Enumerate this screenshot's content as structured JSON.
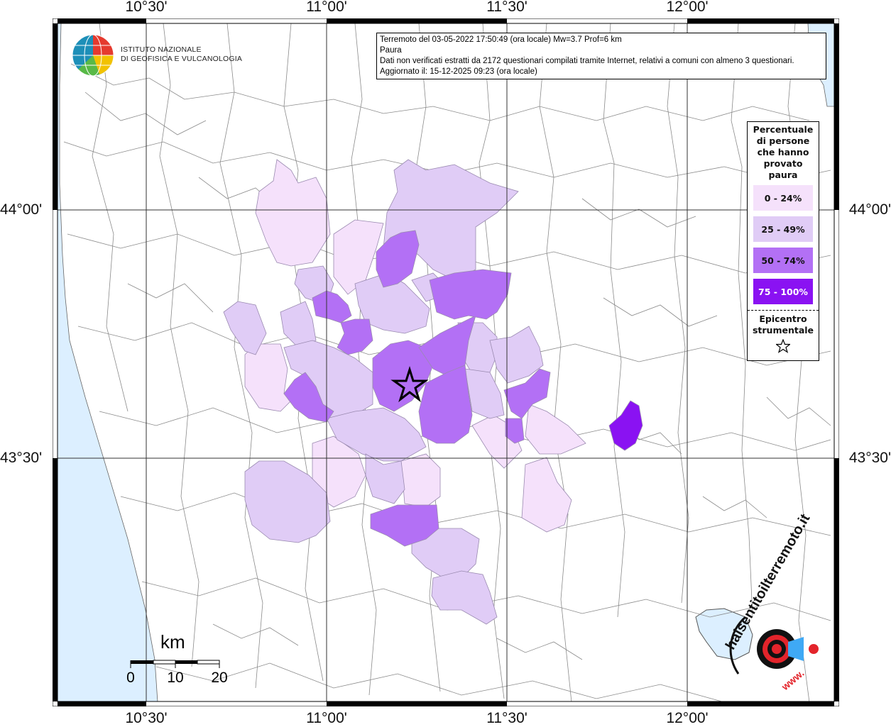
{
  "info": {
    "line1": "Terremoto del 03-05-2022 17:50:49 (ora locale) Mw=3.7 Prof=6 km",
    "line2": "Paura",
    "line3": "Dati non verificati estratti da 2172 questionari compilati tramite Internet, relativi a comuni con almeno 3 questionari.",
    "line4": "Aggiornato il: 15-12-2025 09:23 (ora locale)"
  },
  "logo": {
    "line1": "ISTITUTO NAZIONALE",
    "line2": "DI GEOFISICA E VULCANOLOGIA"
  },
  "watermark": {
    "text": "haisentitoilterremoto.it",
    "url": "www."
  },
  "axes": {
    "lon_ticks": [
      "10°30'",
      "11°00'",
      "11°30'",
      "12°00'"
    ],
    "lat_ticks": [
      "44°00'",
      "43°30'"
    ]
  },
  "legend": {
    "title_lines": [
      "Percentuale",
      "di persone",
      "che hanno",
      "provato",
      "paura"
    ],
    "classes": [
      {
        "label": "0 - 24%",
        "color": "#f5e1fb",
        "text_color": "#111111"
      },
      {
        "label": "25 - 49%",
        "color": "#e0ccf6",
        "text_color": "#111111"
      },
      {
        "label": "50 - 74%",
        "color": "#b370f5",
        "text_color": "#111111"
      },
      {
        "label": "75 - 100%",
        "color": "#8a12f2",
        "text_color": "#ffffff"
      }
    ],
    "epicenter_lines": [
      "Epicentro",
      "strumentale"
    ]
  },
  "scale": {
    "unit": "km",
    "labels": [
      "0",
      "10",
      "20"
    ]
  },
  "colors": {
    "sea": "#dcefff",
    "border": "#888888",
    "grid": "#333333"
  }
}
